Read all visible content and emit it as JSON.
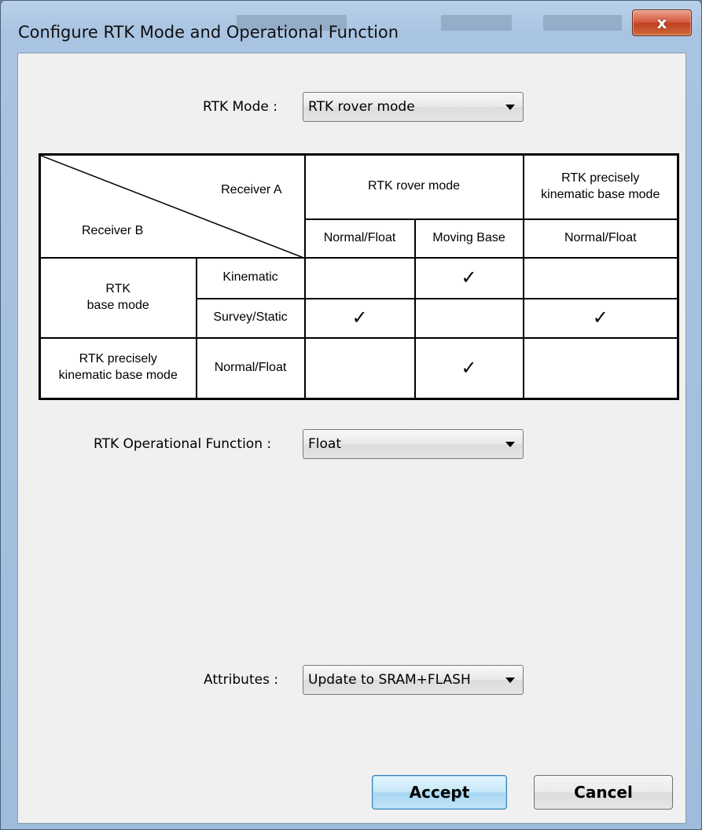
{
  "window": {
    "title": "Configure RTK Mode and Operational Function",
    "close_label": "x"
  },
  "rtk_mode": {
    "label": "RTK Mode :",
    "value": "RTK rover mode"
  },
  "matrix": {
    "receiver_a": "Receiver A",
    "receiver_b": "Receiver B",
    "col_groups": [
      "RTK rover mode",
      "RTK precisely\nkinematic base mode"
    ],
    "sub_cols": [
      "Normal/Float",
      "Moving Base",
      "Normal/Float"
    ],
    "row_groups": [
      "RTK\nbase mode",
      "RTK precisely\nkinematic base mode"
    ],
    "sub_rows": [
      "Kinematic",
      "Survey/Static",
      "Normal/Float"
    ],
    "check_glyph": "✓",
    "checks": [
      [
        false,
        true,
        false
      ],
      [
        true,
        false,
        true
      ],
      [
        false,
        true,
        false
      ]
    ]
  },
  "operational_function": {
    "label": "RTK Operational Function :",
    "value": "Float"
  },
  "attributes": {
    "label": "Attributes :",
    "value": "Update to SRAM+FLASH"
  },
  "buttons": {
    "accept": "Accept",
    "cancel": "Cancel"
  }
}
